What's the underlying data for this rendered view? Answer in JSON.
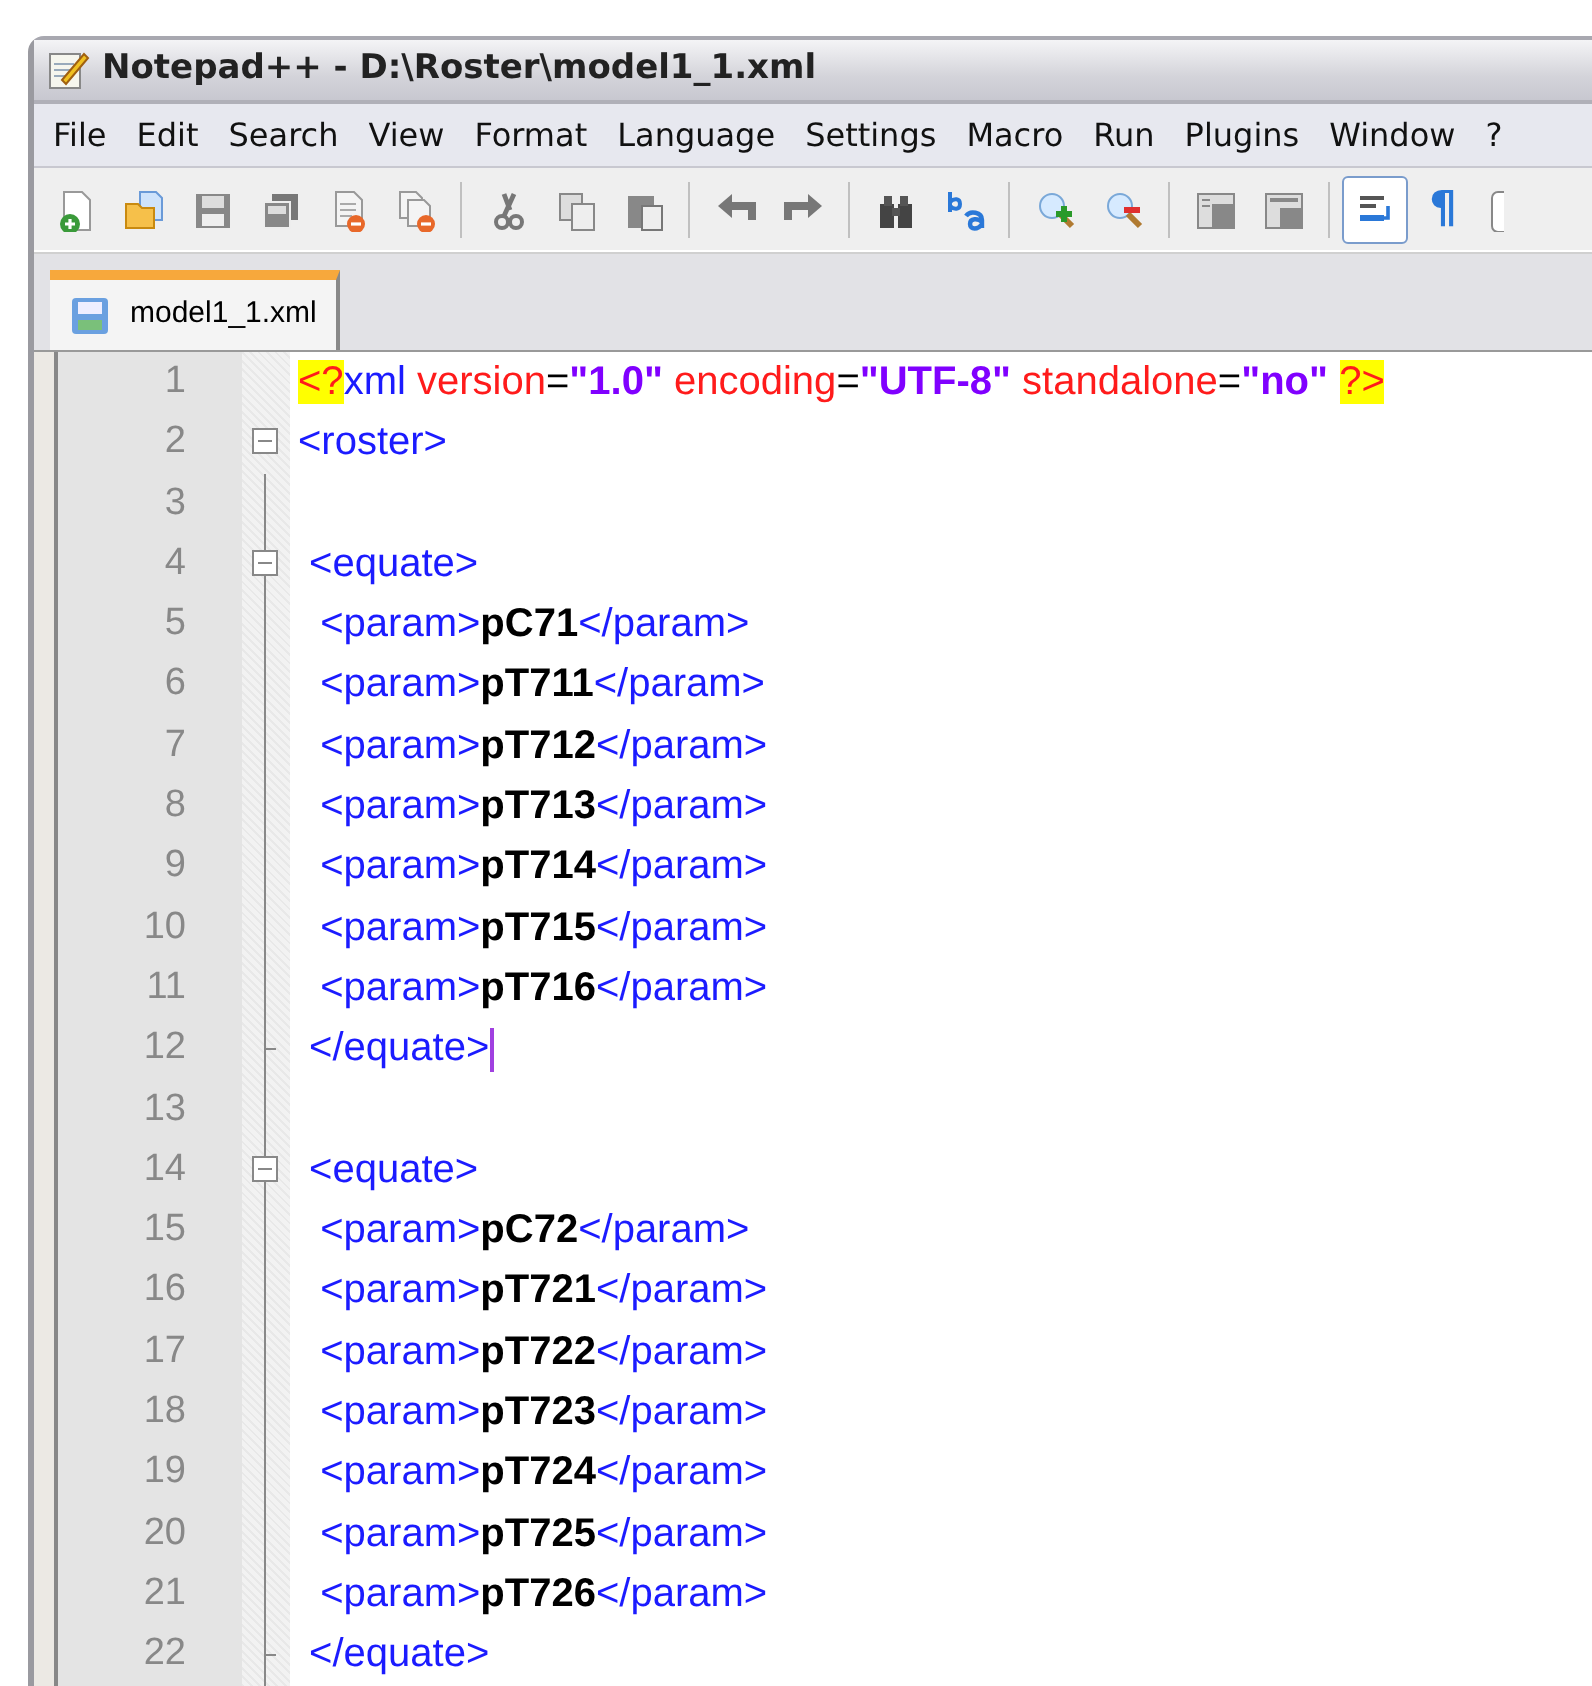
{
  "window": {
    "title": "Notepad++ - D:\\Roster\\model1_1.xml"
  },
  "menu": [
    "File",
    "Edit",
    "Search",
    "View",
    "Format",
    "Language",
    "Settings",
    "Macro",
    "Run",
    "Plugins",
    "Window",
    "?"
  ],
  "toolbar": [
    {
      "kind": "new",
      "pressed": false
    },
    {
      "kind": "open",
      "pressed": false
    },
    {
      "kind": "save",
      "pressed": false
    },
    {
      "kind": "saveall",
      "pressed": false
    },
    {
      "kind": "close",
      "pressed": false
    },
    {
      "kind": "closeall",
      "pressed": false
    },
    {
      "kind": "separator"
    },
    {
      "kind": "cut",
      "pressed": false
    },
    {
      "kind": "copy",
      "pressed": false
    },
    {
      "kind": "paste",
      "pressed": false
    },
    {
      "kind": "separator"
    },
    {
      "kind": "undo",
      "pressed": false
    },
    {
      "kind": "redo",
      "pressed": false
    },
    {
      "kind": "separator"
    },
    {
      "kind": "find",
      "pressed": false
    },
    {
      "kind": "replace",
      "pressed": false
    },
    {
      "kind": "separator"
    },
    {
      "kind": "zoomin",
      "pressed": false
    },
    {
      "kind": "zoomout",
      "pressed": false
    },
    {
      "kind": "separator"
    },
    {
      "kind": "syncv",
      "pressed": false
    },
    {
      "kind": "synch",
      "pressed": false
    },
    {
      "kind": "separator"
    },
    {
      "kind": "wrap",
      "pressed": true
    },
    {
      "kind": "char",
      "label": "¶",
      "pressed": false
    },
    {
      "kind": "partial",
      "pressed": false
    }
  ],
  "tabs": [
    {
      "label": "model1_1.xml",
      "selected": true
    }
  ],
  "editor": {
    "lines": [
      {
        "number": "1",
        "kind": "plain",
        "tokens": [
          {
            "kind": "decl",
            "text": "<?"
          },
          {
            "kind": "tag",
            "text": "xml "
          },
          {
            "kind": "attr",
            "text": "version"
          },
          {
            "kind": "eq",
            "text": "="
          },
          {
            "kind": "value",
            "text": "\"1.0\""
          },
          {
            "kind": "attr",
            "text": " encoding"
          },
          {
            "kind": "eq",
            "text": "="
          },
          {
            "kind": "value",
            "text": "\"UTF-8\""
          },
          {
            "kind": "attr",
            "text": " standalone"
          },
          {
            "kind": "eq",
            "text": "="
          },
          {
            "kind": "value",
            "text": "\"no\" "
          },
          {
            "kind": "decl",
            "text": "?>"
          }
        ]
      },
      {
        "number": "2",
        "kind": "fold_open",
        "tokens": [
          {
            "kind": "tag",
            "text": "<roster>"
          }
        ]
      },
      {
        "number": "3",
        "kind": "fold_body"
      },
      {
        "number": "4",
        "kind": "fold_open",
        "tokens": [
          {
            "kind": "tag",
            "text": " <equate>"
          }
        ]
      },
      {
        "number": "5",
        "kind": "fold_body",
        "tokens": [
          {
            "kind": "tag",
            "text": "  <param>"
          },
          {
            "kind": "text",
            "text": "pC71"
          },
          {
            "kind": "tag",
            "text": "</param>"
          }
        ]
      },
      {
        "number": "6",
        "kind": "fold_body",
        "tokens": [
          {
            "kind": "tag",
            "text": "  <param>"
          },
          {
            "kind": "text",
            "text": "pT711"
          },
          {
            "kind": "tag",
            "text": "</param>"
          }
        ]
      },
      {
        "number": "7",
        "kind": "fold_body",
        "tokens": [
          {
            "kind": "tag",
            "text": "  <param>"
          },
          {
            "kind": "text",
            "text": "pT712"
          },
          {
            "kind": "tag",
            "text": "</param>"
          }
        ]
      },
      {
        "number": "8",
        "kind": "fold_body",
        "tokens": [
          {
            "kind": "tag",
            "text": "  <param>"
          },
          {
            "kind": "text",
            "text": "pT713"
          },
          {
            "kind": "tag",
            "text": "</param>"
          }
        ]
      },
      {
        "number": "9",
        "kind": "fold_body",
        "tokens": [
          {
            "kind": "tag",
            "text": "  <param>"
          },
          {
            "kind": "text",
            "text": "pT714"
          },
          {
            "kind": "tag",
            "text": "</param>"
          }
        ]
      },
      {
        "number": "10",
        "kind": "fold_body",
        "tokens": [
          {
            "kind": "tag",
            "text": "  <param>"
          },
          {
            "kind": "text",
            "text": "pT715"
          },
          {
            "kind": "tag",
            "text": "</param>"
          }
        ]
      },
      {
        "number": "11",
        "kind": "fold_body",
        "tokens": [
          {
            "kind": "tag",
            "text": "  <param>"
          },
          {
            "kind": "text",
            "text": "pT716"
          },
          {
            "kind": "tag",
            "text": "</param>"
          }
        ]
      },
      {
        "number": "12",
        "kind": "fold_end",
        "caret": true,
        "tokens": [
          {
            "kind": "tag",
            "text": " </equate>"
          }
        ]
      },
      {
        "number": "13",
        "kind": "fold_body"
      },
      {
        "number": "14",
        "kind": "fold_open",
        "tokens": [
          {
            "kind": "tag",
            "text": " <equate>"
          }
        ]
      },
      {
        "number": "15",
        "kind": "fold_body",
        "tokens": [
          {
            "kind": "tag",
            "text": "  <param>"
          },
          {
            "kind": "text",
            "text": "pC72"
          },
          {
            "kind": "tag",
            "text": "</param>"
          }
        ]
      },
      {
        "number": "16",
        "kind": "fold_body",
        "tokens": [
          {
            "kind": "tag",
            "text": "  <param>"
          },
          {
            "kind": "text",
            "text": "pT721"
          },
          {
            "kind": "tag",
            "text": "</param>"
          }
        ]
      },
      {
        "number": "17",
        "kind": "fold_body",
        "tokens": [
          {
            "kind": "tag",
            "text": "  <param>"
          },
          {
            "kind": "text",
            "text": "pT722"
          },
          {
            "kind": "tag",
            "text": "</param>"
          }
        ]
      },
      {
        "number": "18",
        "kind": "fold_body",
        "tokens": [
          {
            "kind": "tag",
            "text": "  <param>"
          },
          {
            "kind": "text",
            "text": "pT723"
          },
          {
            "kind": "tag",
            "text": "</param>"
          }
        ]
      },
      {
        "number": "19",
        "kind": "fold_body",
        "tokens": [
          {
            "kind": "tag",
            "text": "  <param>"
          },
          {
            "kind": "text",
            "text": "pT724"
          },
          {
            "kind": "tag",
            "text": "</param>"
          }
        ]
      },
      {
        "number": "20",
        "kind": "fold_body",
        "tokens": [
          {
            "kind": "tag",
            "text": "  <param>"
          },
          {
            "kind": "text",
            "text": "pT725"
          },
          {
            "kind": "tag",
            "text": "</param>"
          }
        ]
      },
      {
        "number": "21",
        "kind": "fold_body",
        "tokens": [
          {
            "kind": "tag",
            "text": "  <param>"
          },
          {
            "kind": "text",
            "text": "pT726"
          },
          {
            "kind": "tag",
            "text": "</param>"
          }
        ]
      },
      {
        "number": "22",
        "kind": "fold_end",
        "tokens": [
          {
            "kind": "tag",
            "text": " </equate>"
          }
        ]
      }
    ]
  }
}
